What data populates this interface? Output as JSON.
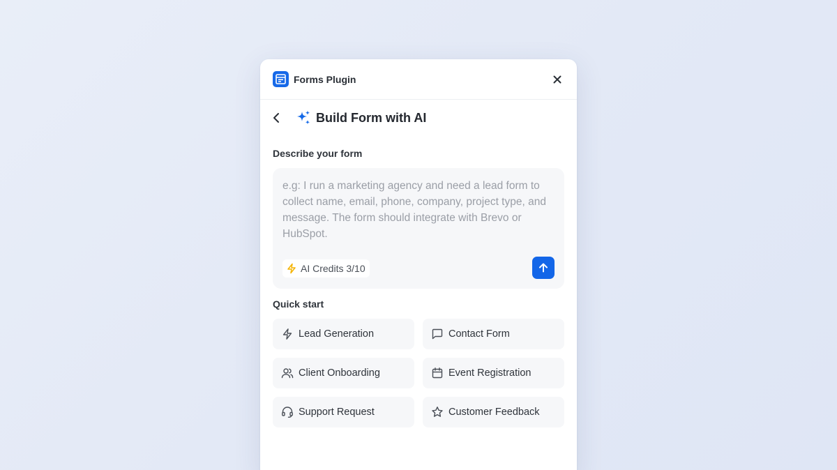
{
  "header": {
    "title": "Forms Plugin",
    "logo_icon": "form-layout-icon",
    "close_icon": "close-icon"
  },
  "subheader": {
    "title": "Build Form with AI",
    "back_icon": "chevron-left-icon",
    "sparkle_icon": "sparkle-icon"
  },
  "describe": {
    "label": "Describe your form",
    "placeholder": "e.g: I run a marketing agency and need a lead form to collect name, email, phone, company, project type, and message. The form should integrate with Brevo or HubSpot.",
    "credits_label": "AI Credits 3/10",
    "credits_icon": "bolt-icon",
    "send_icon": "arrow-up-icon"
  },
  "quick_start": {
    "label": "Quick start",
    "items": [
      {
        "label": "Lead Generation",
        "icon": "bolt-icon"
      },
      {
        "label": "Contact Form",
        "icon": "message-square-icon"
      },
      {
        "label": "Client Onboarding",
        "icon": "users-icon"
      },
      {
        "label": "Event Registration",
        "icon": "calendar-icon"
      },
      {
        "label": "Support Request",
        "icon": "headset-icon"
      },
      {
        "label": "Customer Feedback",
        "icon": "star-icon"
      }
    ]
  },
  "colors": {
    "accent": "#1366e8",
    "credits_bolt": "#f5b301"
  }
}
